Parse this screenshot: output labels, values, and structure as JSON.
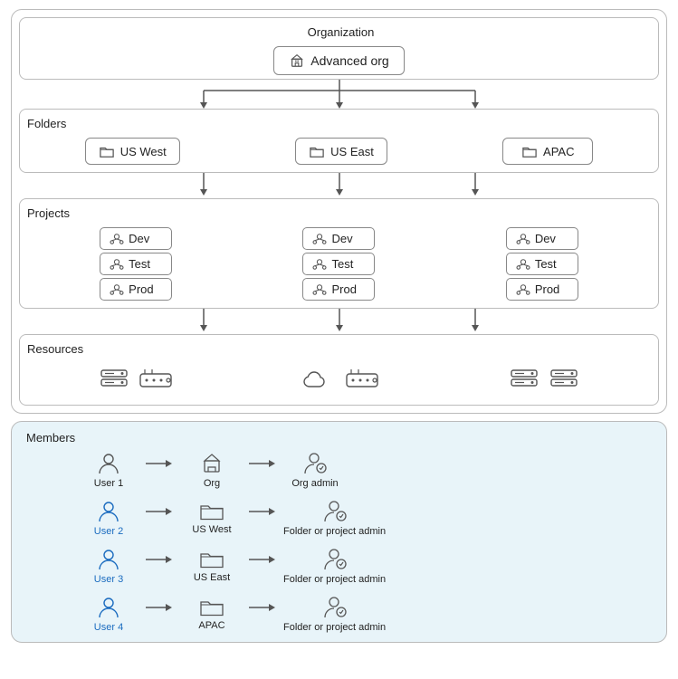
{
  "org": {
    "label": "Organization",
    "node": "Advanced org"
  },
  "folders": {
    "label": "Folders",
    "items": [
      "US West",
      "US East",
      "APAC"
    ]
  },
  "projects": {
    "label": "Projects",
    "groups": [
      [
        "Dev",
        "Test",
        "Prod"
      ],
      [
        "Dev",
        "Test",
        "Prod"
      ],
      [
        "Dev",
        "Test",
        "Prod"
      ]
    ]
  },
  "resources": {
    "label": "Resources"
  },
  "members": {
    "label": "Members",
    "rows": [
      {
        "user": "User 1",
        "target": "Org",
        "role": "Org admin"
      },
      {
        "user": "User 2",
        "target": "US West",
        "role": "Folder or project admin"
      },
      {
        "user": "User 3",
        "target": "US East",
        "role": "Folder or project admin"
      },
      {
        "user": "User 4",
        "target": "APAC",
        "role": "Folder or project admin"
      }
    ]
  }
}
